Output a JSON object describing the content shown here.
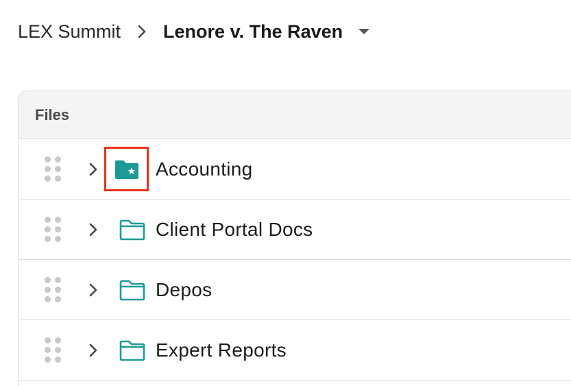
{
  "breadcrumb": {
    "root": "LEX Summit",
    "current": "Lenore v. The Raven"
  },
  "files": {
    "header": "Files",
    "items": [
      {
        "label": "Accounting",
        "icon": "folder-star-icon",
        "selected": true
      },
      {
        "label": "Client Portal Docs",
        "icon": "folder-outline-icon",
        "selected": false
      },
      {
        "label": "Depos",
        "icon": "folder-outline-icon",
        "selected": false
      },
      {
        "label": "Expert Reports",
        "icon": "folder-outline-icon",
        "selected": false
      }
    ]
  },
  "colors": {
    "accent": "#1a9b96",
    "highlight": "#e8331c",
    "border": "#dcdcdc",
    "header_bg": "#f4f4f4"
  }
}
